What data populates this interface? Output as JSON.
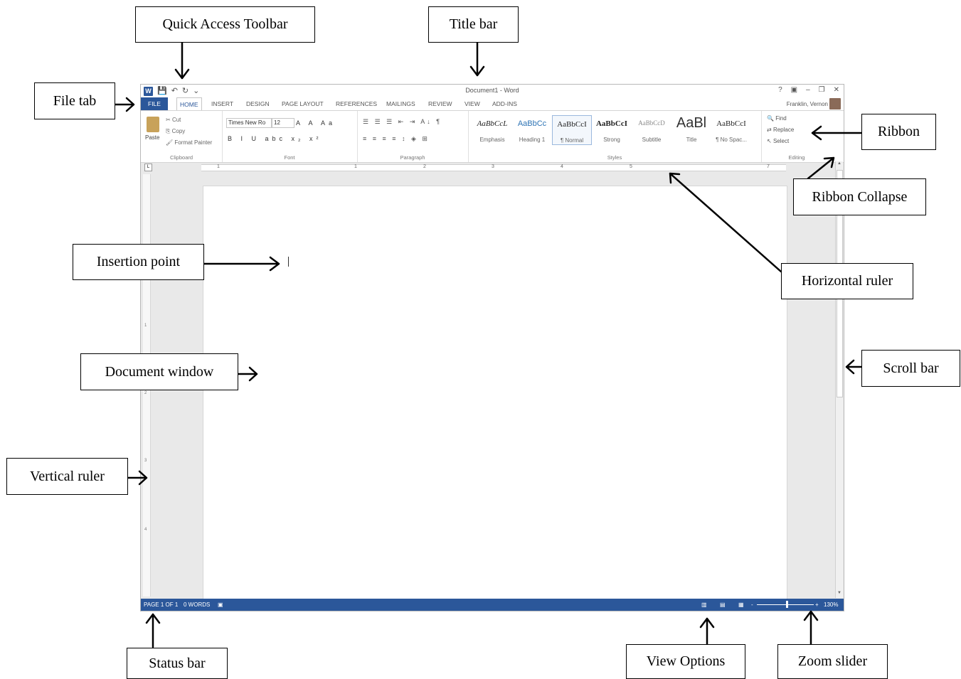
{
  "window": {
    "title": "Document1 - Word",
    "quick_access": {
      "undo_glyph": "↶",
      "redo_glyph": "↻",
      "more_glyph": "⌄"
    },
    "controls": [
      "?",
      "▣",
      "–",
      "❐",
      "✕"
    ],
    "user": "Franklin, Vernon",
    "tabs": [
      "FILE",
      "HOME",
      "INSERT",
      "DESIGN",
      "PAGE LAYOUT",
      "REFERENCES",
      "MAILINGS",
      "REVIEW",
      "VIEW",
      "ADD-INS"
    ],
    "active_tab": "HOME"
  },
  "ribbon": {
    "clipboard": {
      "paste": "Paste",
      "cut": "Cut",
      "copy": "Copy",
      "format_painter": "Format Painter",
      "label": "Clipboard"
    },
    "font": {
      "name": "Times New Ro",
      "size": "12",
      "label": "Font",
      "format_buttons": "B I U abc x₂ x²"
    },
    "paragraph": {
      "label": "Paragraph",
      "row1": "☰ ☰ ☰ ⇤ ⇥ A↓ ¶",
      "row2": "≡ ≡ ≡ ≡ ↕ ◈ ⊞"
    },
    "styles": {
      "label": "Styles",
      "items": [
        {
          "preview": "AaBbCcL",
          "name": "Emphasis"
        },
        {
          "preview": "AaBbCc",
          "name": "Heading 1"
        },
        {
          "preview": "AaBbCcI",
          "name": "¶ Normal"
        },
        {
          "preview": "AaBbCcI",
          "name": "Strong"
        },
        {
          "preview": "AaBbCcD",
          "name": "Subtitle"
        },
        {
          "preview": "AaBl",
          "name": "Title"
        },
        {
          "preview": "AaBbCcI",
          "name": "¶ No Spac..."
        }
      ]
    },
    "editing": {
      "find": "Find",
      "replace": "Replace",
      "select": "Select",
      "label": "Editing"
    }
  },
  "ruler": {
    "h_marks": [
      "1",
      "1",
      "2",
      "3",
      "4",
      "5",
      "7"
    ],
    "v_marks": [
      "1",
      "2",
      "3",
      "4"
    ]
  },
  "status": {
    "page": "PAGE 1 OF 1",
    "words": "0 WORDS",
    "zoom": "130%",
    "zoom_minus": "-",
    "zoom_plus": "+"
  },
  "callouts": {
    "quick_access_toolbar": "Quick Access Toolbar",
    "title_bar": "Title bar",
    "file_tab": "File tab",
    "ribbon": "Ribbon",
    "ribbon_collapse": "Ribbon Collapse",
    "insertion_point": "Insertion point",
    "horizontal_ruler": "Horizontal ruler",
    "document_window": "Document window",
    "scroll_bar": "Scroll bar",
    "vertical_ruler": "Vertical ruler",
    "status_bar": "Status bar",
    "view_options": "View Options",
    "zoom_slider": "Zoom slider"
  }
}
